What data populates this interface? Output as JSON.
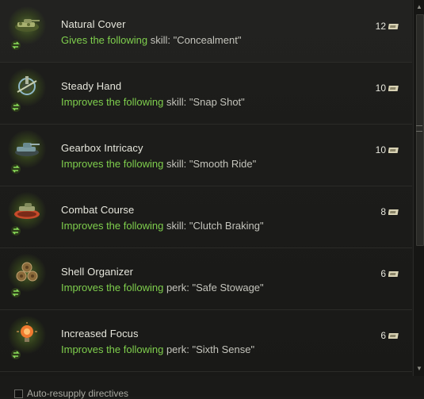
{
  "items": [
    {
      "title": "Natural Cover",
      "desc_highlight": "Gives the following",
      "desc_rest": " skill: \"Concealment\"",
      "price": "12",
      "icon": "camouflaged-tank-icon"
    },
    {
      "title": "Steady Hand",
      "desc_highlight": "Improves the following",
      "desc_rest": " skill: \"Snap Shot\"",
      "price": "10",
      "icon": "gun-mantlet-icon"
    },
    {
      "title": "Gearbox Intricacy",
      "desc_highlight": "Improves the following",
      "desc_rest": " skill: \"Smooth Ride\"",
      "price": "10",
      "icon": "tank-icon"
    },
    {
      "title": "Combat Course",
      "desc_highlight": "Improves the following",
      "desc_rest": " skill: \"Clutch Braking\"",
      "price": "8",
      "icon": "tank-track-icon"
    },
    {
      "title": "Shell Organizer",
      "desc_highlight": "Improves the following",
      "desc_rest": " perk: \"Safe Stowage\"",
      "price": "6",
      "icon": "shells-icon"
    },
    {
      "title": "Increased Focus",
      "desc_highlight": "Improves the following",
      "desc_rest": " perk: \"Sixth Sense\"",
      "price": "6",
      "icon": "lightbulb-icon"
    }
  ],
  "footer": {
    "auto_resupply_label": "Auto-resupply directives",
    "auto_resupply_checked": false
  },
  "colors": {
    "highlight": "#7fcf4d",
    "background": "#1c1c1a"
  }
}
